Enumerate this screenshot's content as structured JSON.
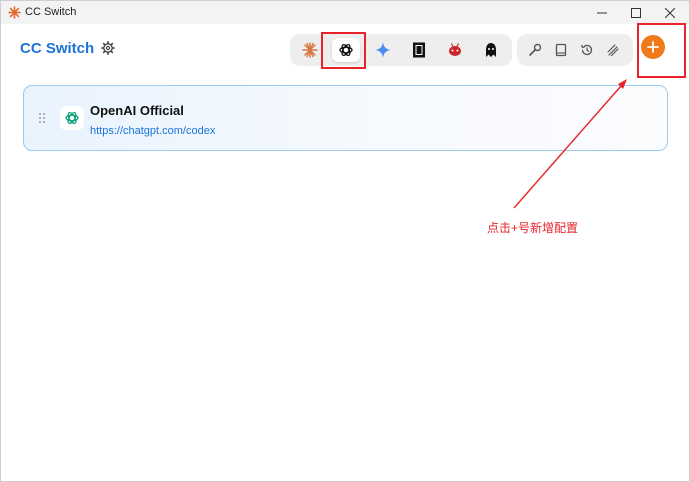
{
  "window": {
    "title": "CC Switch"
  },
  "header": {
    "brand": "CC Switch"
  },
  "app_tabs": [
    {
      "icon": "claude-icon",
      "active": false
    },
    {
      "icon": "openai-icon",
      "active": true
    },
    {
      "icon": "gemini-icon",
      "active": false
    },
    {
      "icon": "cursor-icon",
      "active": false
    },
    {
      "icon": "mascot-icon",
      "active": false
    },
    {
      "icon": "character-icon",
      "active": false
    }
  ],
  "tools": [
    "wrench-icon",
    "book-icon",
    "history-icon",
    "fingerprint-icon"
  ],
  "provider": {
    "name": "OpenAI Official",
    "url": "https://chatgpt.com/codex"
  },
  "annotation": {
    "text": "点击+号新增配置"
  },
  "colors": {
    "accent": "#1a73d9",
    "add": "#f07a1a",
    "annotation": "#e8232a"
  }
}
